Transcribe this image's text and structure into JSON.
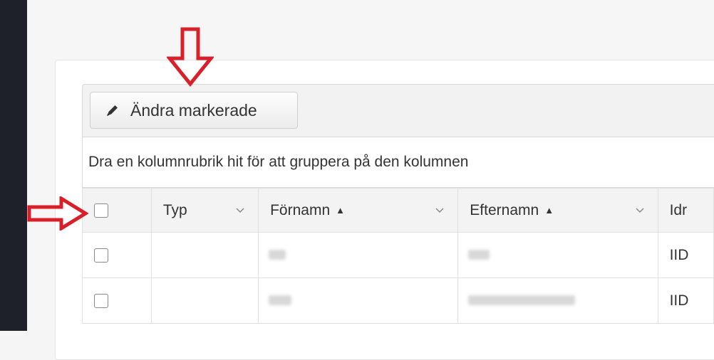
{
  "toolbar": {
    "edit_selected_label": "Ändra markerade",
    "edit_icon": "pencil-icon"
  },
  "group_area": {
    "hint": "Dra en kolumnrubrik hit för att gruppera på den kolumnen"
  },
  "columns": [
    {
      "label": "Typ",
      "sort": ""
    },
    {
      "label": "Förnamn",
      "sort": "▲"
    },
    {
      "label": "Efternamn",
      "sort": "▲"
    },
    {
      "label": "Idr",
      "sort": ""
    }
  ],
  "rows": [
    {
      "id_prefix": "IID"
    },
    {
      "id_prefix": "IID"
    }
  ],
  "annotations": {
    "color": "#d9202a",
    "arrows": [
      "down-arrow-to-edit-button",
      "right-arrow-to-select-all-checkbox"
    ]
  }
}
